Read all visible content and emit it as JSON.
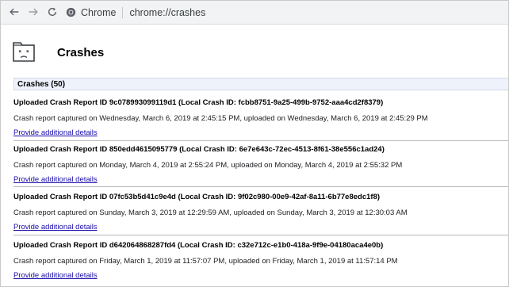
{
  "toolbar": {
    "site_chip": "Chrome",
    "url": "chrome://crashes"
  },
  "page": {
    "title": "Crashes",
    "count_label": "Crashes (50)"
  },
  "reports": [
    {
      "title": "Uploaded Crash Report ID 9c078993099119d1 (Local Crash ID: fcbb8751-9a25-499b-9752-aaa4cd2f8379)",
      "time": "Crash report captured on Wednesday, March 6, 2019 at 2:45:15 PM, uploaded on Wednesday, March 6, 2019 at 2:45:29 PM",
      "link": "Provide additional details"
    },
    {
      "title": "Uploaded Crash Report ID 850edd4615095779 (Local Crash ID: 6e7e643c-72ec-4513-8f61-38e556c1ad24)",
      "time": "Crash report captured on Monday, March 4, 2019 at 2:55:24 PM, uploaded on Monday, March 4, 2019 at 2:55:32 PM",
      "link": "Provide additional details"
    },
    {
      "title": "Uploaded Crash Report ID 07fc53b5d41c9e4d (Local Crash ID: 9f02c980-00e9-42af-8a11-6b77e8edc1f8)",
      "time": "Crash report captured on Sunday, March 3, 2019 at 12:29:59 AM, uploaded on Sunday, March 3, 2019 at 12:30:03 AM",
      "link": "Provide additional details"
    },
    {
      "title": "Uploaded Crash Report ID d642064868287fd4 (Local Crash ID: c32e712c-e1b0-418a-9f9e-04180aca4e0b)",
      "time": "Crash report captured on Friday, March 1, 2019 at 11:57:07 PM, uploaded on Friday, March 1, 2019 at 11:57:14 PM",
      "link": "Provide additional details"
    }
  ]
}
